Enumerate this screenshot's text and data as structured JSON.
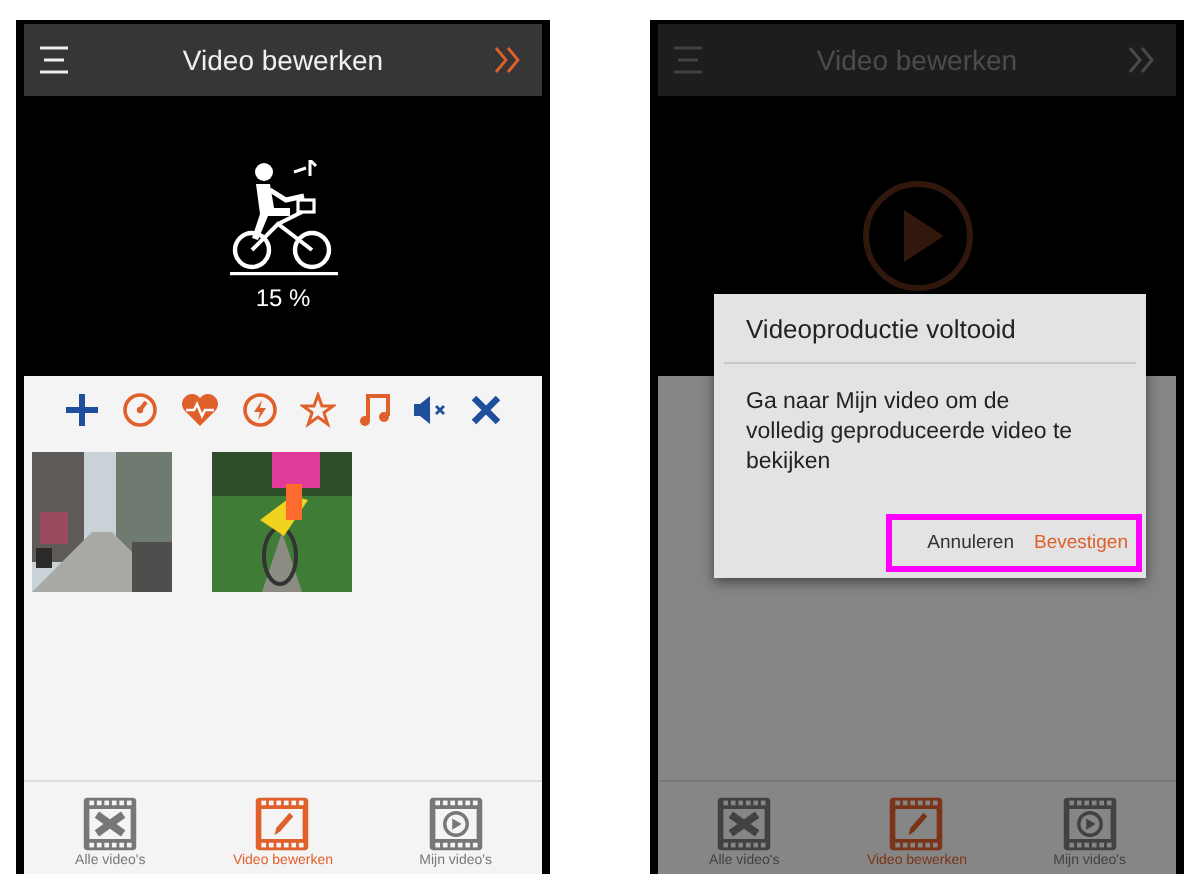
{
  "screens": [
    {
      "kind": "editor",
      "header": {
        "title": "Video bewerken"
      },
      "progress": "15 %",
      "nav": [
        {
          "label": "Alle video's",
          "selected": false
        },
        {
          "label": "Video bewerken",
          "selected": true
        },
        {
          "label": "Mijn video's",
          "selected": false
        }
      ]
    },
    {
      "kind": "finished",
      "header": {
        "title": "Video bewerken"
      },
      "dialog": {
        "title": "Videoproductie voltooid",
        "message": "Ga naar Mijn video om de volledig geproduceerde video te bekijken",
        "buttons": [
          {
            "label": "Annuleren",
            "kind": "cancel"
          },
          {
            "label": "Bevestigen",
            "kind": "confirm"
          }
        ],
        "buttons_highlighted": true
      },
      "nav": [
        {
          "label": "Alle video's",
          "selected": false
        },
        {
          "label": "Video bewerken",
          "selected": true
        },
        {
          "label": "Mijn video's",
          "selected": false
        }
      ]
    }
  ]
}
